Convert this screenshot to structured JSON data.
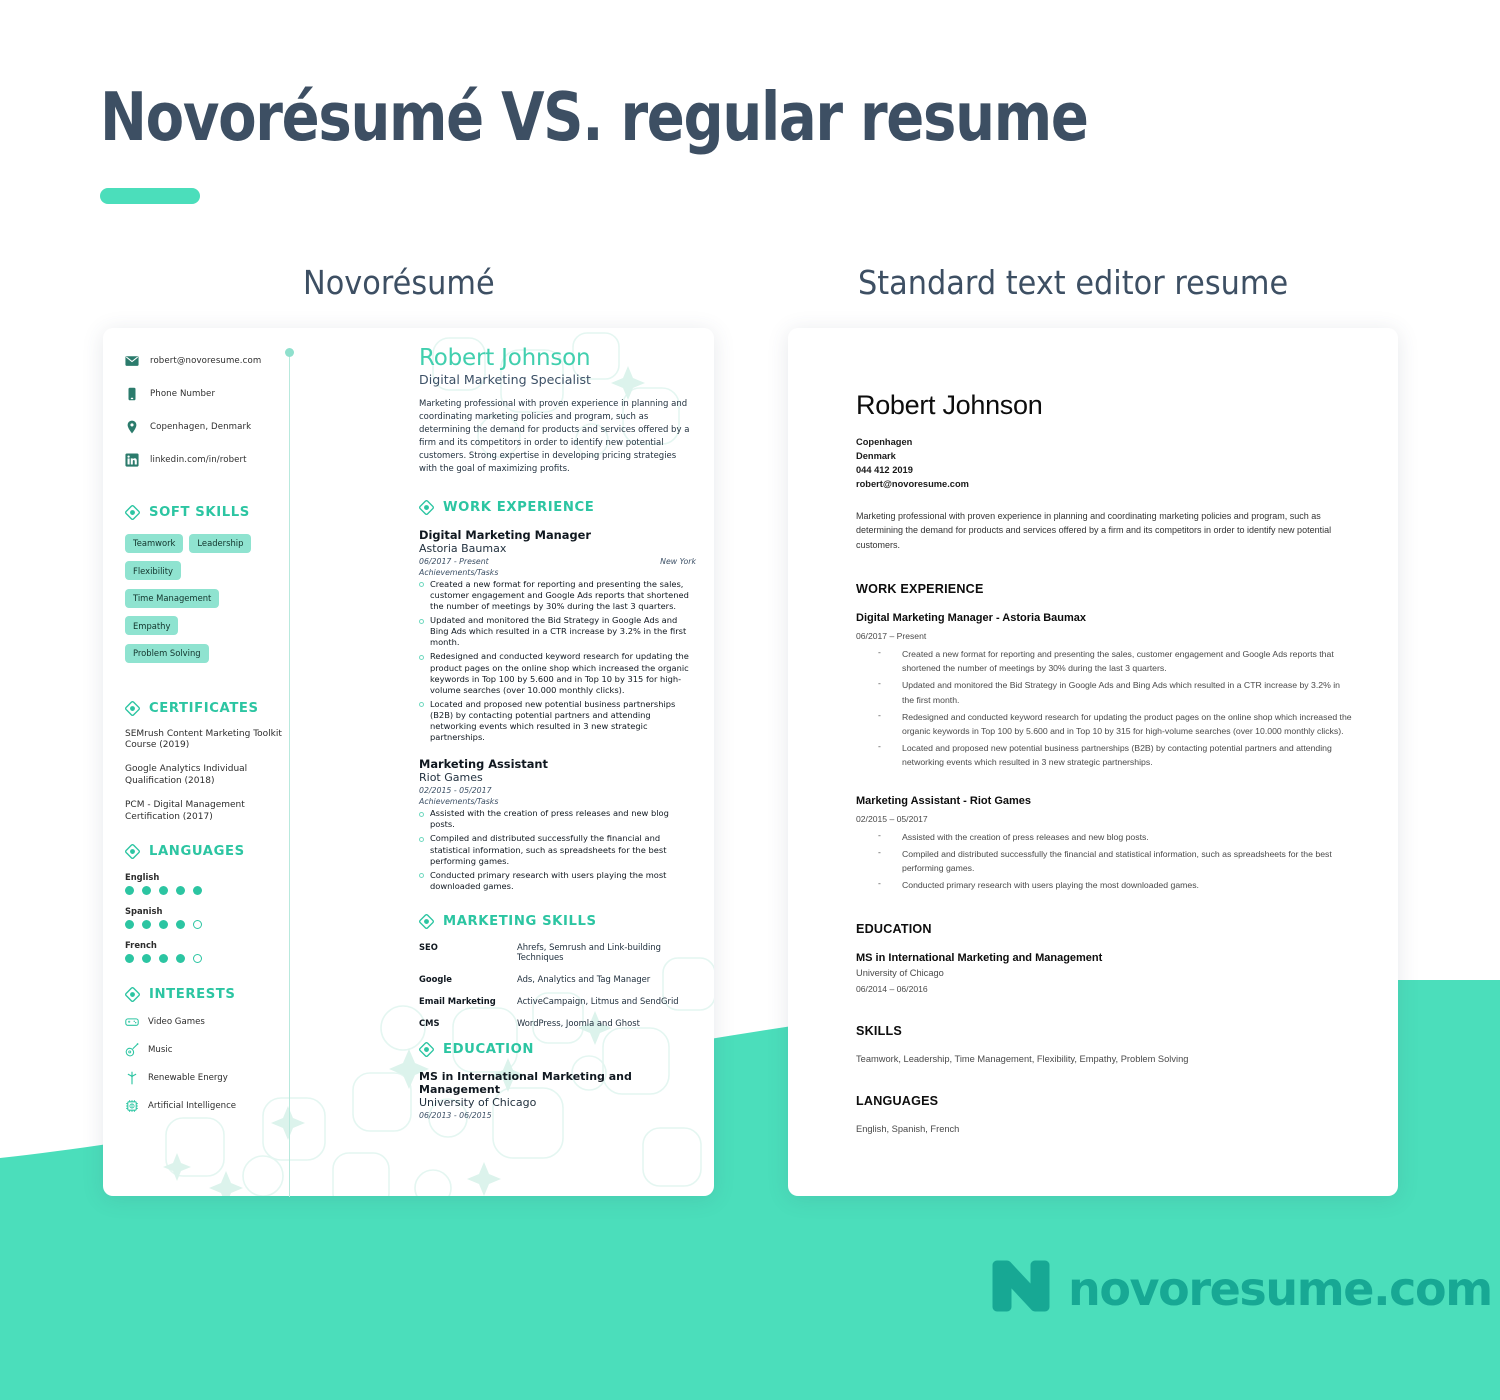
{
  "header": {
    "title": "Novorésumé VS. regular resume",
    "accent_color": "#4BDEBB",
    "title_color": "#3d4f63",
    "label_left": "Novorésumé",
    "label_right": "Standard text editor resume"
  },
  "novoresume": {
    "contacts": [
      {
        "icon": "envelope-icon",
        "text": "robert@novoresume.com"
      },
      {
        "icon": "phone-icon",
        "text": "Phone Number"
      },
      {
        "icon": "location-pin-icon",
        "text": "Copenhagen, Denmark"
      },
      {
        "icon": "linkedin-icon",
        "text": "linkedin.com/in/robert"
      }
    ],
    "soft_skills": {
      "heading": "SOFT SKILLS",
      "items": [
        "Teamwork",
        "Leadership",
        "Flexibility",
        "Time Management",
        "Empathy",
        "Problem Solving"
      ]
    },
    "certificates": {
      "heading": "CERTIFICATES",
      "items": [
        "SEMrush Content Marketing Toolkit Course (2019)",
        "Google Analytics Individual Qualification (2018)",
        "PCM - Digital Management Certification (2017)"
      ]
    },
    "languages": {
      "heading": "LANGUAGES",
      "items": [
        {
          "name": "English",
          "level": 5,
          "max": 5
        },
        {
          "name": "Spanish",
          "level": 4,
          "max": 5
        },
        {
          "name": "French",
          "level": 4,
          "max": 5
        }
      ]
    },
    "interests": {
      "heading": "INTERESTS",
      "items": [
        {
          "icon": "gamepad-icon",
          "label": "Video Games"
        },
        {
          "icon": "guitar-icon",
          "label": "Music"
        },
        {
          "icon": "wind-turbine-icon",
          "label": "Renewable Energy"
        },
        {
          "icon": "microchip-icon",
          "label": "Artificial Intelligence"
        }
      ]
    },
    "name": "Robert Johnson",
    "role": "Digital Marketing Specialist",
    "summary": "Marketing professional with proven experience in planning and coordinating marketing policies and program, such as determining the demand for products and services offered by a firm and its competitors in order to identify new potential customers. Strong expertise in developing pricing strategies with the goal of maximizing profits.",
    "work": {
      "heading": "WORK EXPERIENCE",
      "jobs": [
        {
          "title": "Digital Marketing Manager",
          "company": "Astoria Baumax",
          "date": "06/2017 - Present",
          "location": "New York",
          "ach_label": "Achievements/Tasks",
          "bullets": [
            "Created a new format for reporting and presenting the sales, customer engagement and Google Ads reports that shortened the number of meetings by 30% during the last 3 quarters.",
            "Updated and monitored the Bid Strategy in Google Ads and Bing Ads which resulted in a CTR increase by 3.2% in the first month.",
            "Redesigned and conducted keyword research for updating the product pages on the online shop which increased the organic keywords in Top 100 by 5.600 and in Top 10 by 315 for high-volume searches (over 10.000 monthly clicks).",
            "Located and proposed new potential business partnerships (B2B) by contacting potential partners and attending networking events which resulted in 3 new strategic partnerships."
          ]
        },
        {
          "title": "Marketing Assistant",
          "company": "Riot Games",
          "date": "02/2015 - 05/2017",
          "location": "",
          "ach_label": "Achievements/Tasks",
          "bullets": [
            "Assisted with the creation of press releases and new blog posts.",
            "Compiled and distributed successfully the financial and statistical information, such as spreadsheets for the best performing games.",
            "Conducted primary research with users playing the most downloaded games."
          ]
        }
      ]
    },
    "marketing_skills": {
      "heading": "MARKETING SKILLS",
      "rows": [
        {
          "key": "SEO",
          "value": "Ahrefs, Semrush and Link-building Techniques"
        },
        {
          "key": "Google",
          "value": "Ads, Analytics and Tag Manager"
        },
        {
          "key": "Email Marketing",
          "value": "ActiveCampaign, Litmus and SendGrid"
        },
        {
          "key": "CMS",
          "value": "WordPress, Joomla and Ghost"
        }
      ]
    },
    "education": {
      "heading": "EDUCATION",
      "degree": "MS in International Marketing and Management",
      "university": "University of Chicago",
      "date": "06/2013 - 06/2015"
    }
  },
  "standard": {
    "name": "Robert Johnson",
    "contact_lines": [
      "Copenhagen",
      "Denmark",
      "044 412 2019",
      "robert@novoresume.com"
    ],
    "summary": "Marketing professional with proven experience in planning and coordinating marketing policies and program, such as determining the demand for products and services offered by a firm and its competitors in order to identify new potential customers.",
    "work_heading": "WORK EXPERIENCE",
    "jobs": [
      {
        "title": "Digital Marketing Manager  -  Astoria Baumax",
        "date": "06/2017 – Present",
        "bullets": [
          "Created a new format for reporting and presenting the sales, customer engagement and Google Ads reports that shortened the number of meetings by 30% during the last 3 quarters.",
          "Updated and monitored the Bid Strategy in Google Ads and Bing Ads which resulted in a CTR increase by 3.2% in the first month.",
          "Redesigned and conducted keyword research for updating the product pages on the online shop which increased the organic keywords in Top 100 by 5.600 and in Top 10 by 315 for high-volume searches (over 10.000 monthly clicks).",
          "Located and proposed new potential business partnerships (B2B) by contacting potential partners and attending networking events which resulted in 3 new strategic partnerships."
        ]
      },
      {
        "title": "Marketing Assistant - Riot Games",
        "date": "02/2015 – 05/2017",
        "bullets": [
          "Assisted with the creation of press releases and new blog posts.",
          "Compiled and distributed successfully the financial and statistical information, such as spreadsheets for the best performing games.",
          "Conducted primary research with users playing the most downloaded games."
        ]
      }
    ],
    "education_heading": "EDUCATION",
    "education_degree": "MS in International Marketing and Management",
    "education_university": "University of Chicago",
    "education_date": "06/2014 – 06/2016",
    "skills_heading": "SKILLS",
    "skills_line": "Teamwork, Leadership, Time Management, Flexibility, Empathy, Problem Solving",
    "languages_heading": "LANGUAGES",
    "languages_line": "English, Spanish, French",
    "bullet_dash": "-"
  },
  "footer": {
    "logo_text": "novoresume.com",
    "logo_color": "#17A894"
  }
}
